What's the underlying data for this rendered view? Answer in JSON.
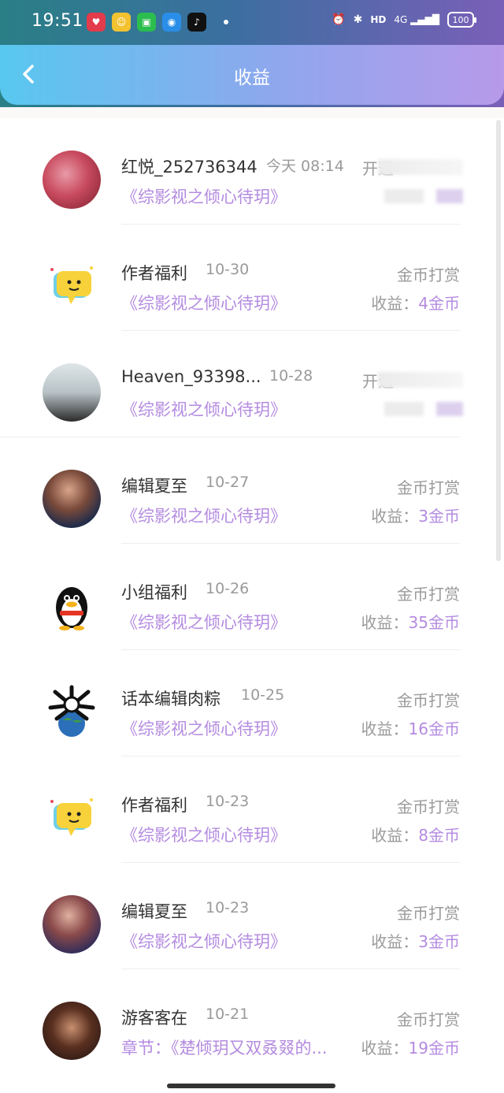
{
  "status_bar": {
    "time": "19:51",
    "battery": "100",
    "hd": "HD",
    "net": "4G"
  },
  "header": {
    "title": "收益"
  },
  "rows": [
    {
      "name": "红悦_252736344",
      "date": "今天 08:14",
      "book": "《综影视之倾心待玥》",
      "type": "开通",
      "earn_label": "",
      "earn_amount": ""
    },
    {
      "name": "作者福利",
      "date": "10-30",
      "book": "《综影视之倾心待玥》",
      "type": "金币打赏",
      "earn_label": "收益：",
      "earn_amount": "4金币"
    },
    {
      "name": "Heaven_93398...",
      "date": "10-28",
      "book": "《综影视之倾心待玥》",
      "type": "开通",
      "earn_label": "",
      "earn_amount": ""
    },
    {
      "name": "编辑夏至",
      "date": "10-27",
      "book": "《综影视之倾心待玥》",
      "type": "金币打赏",
      "earn_label": "收益：",
      "earn_amount": "3金币"
    },
    {
      "name": "小组福利",
      "date": "10-26",
      "book": "《综影视之倾心待玥》",
      "type": "金币打赏",
      "earn_label": "收益：",
      "earn_amount": "35金币"
    },
    {
      "name": "话本编辑肉粽",
      "date": "10-25",
      "book": "《综影视之倾心待玥》",
      "type": "金币打赏",
      "earn_label": "收益：",
      "earn_amount": "16金币"
    },
    {
      "name": "作者福利",
      "date": "10-23",
      "book": "《综影视之倾心待玥》",
      "type": "金币打赏",
      "earn_label": "收益：",
      "earn_amount": "8金币"
    },
    {
      "name": "编辑夏至",
      "date": "10-23",
      "book": "《综影视之倾心待玥》",
      "type": "金币打赏",
      "earn_label": "收益：",
      "earn_amount": "3金币"
    },
    {
      "name": "游客客在",
      "date": "10-21",
      "book": "章节：《楚倾玥又双叒叕的...",
      "type": "金币打赏",
      "earn_label": "收益：",
      "earn_amount": "19金币"
    }
  ],
  "colors": {
    "accent": "#b48be0",
    "muted": "#9a9a9a",
    "text": "#333333"
  }
}
